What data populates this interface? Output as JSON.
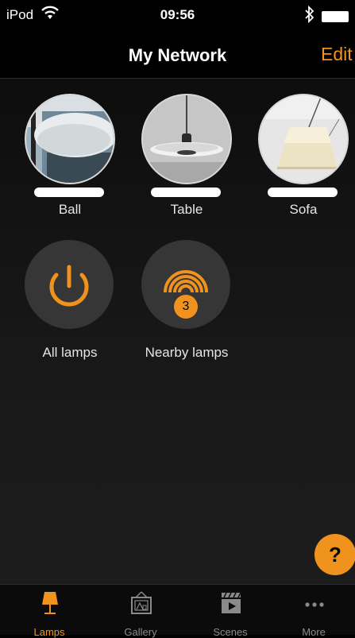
{
  "status_bar": {
    "carrier": "iPod",
    "time": "09:56"
  },
  "navbar": {
    "title": "My Network",
    "edit_label": "Edit"
  },
  "lamps": [
    {
      "name": "Ball",
      "level": 1.0
    },
    {
      "name": "Table",
      "level": 1.0
    },
    {
      "name": "Sofa",
      "level": 1.0
    }
  ],
  "groups": {
    "all_lamps": {
      "label": "All lamps"
    },
    "nearby_lamps": {
      "label": "Nearby lamps",
      "count": "3"
    }
  },
  "help_label": "?",
  "tabs": [
    {
      "label": "Lamps",
      "icon": "lamp-icon",
      "active": true
    },
    {
      "label": "Gallery",
      "icon": "gallery-icon",
      "active": false
    },
    {
      "label": "Scenes",
      "icon": "scenes-icon",
      "active": false
    },
    {
      "label": "More",
      "icon": "more-icon",
      "active": false
    }
  ],
  "colors": {
    "accent": "#f0931e",
    "background": "#1a1a1a",
    "group_disc": "#363636"
  }
}
